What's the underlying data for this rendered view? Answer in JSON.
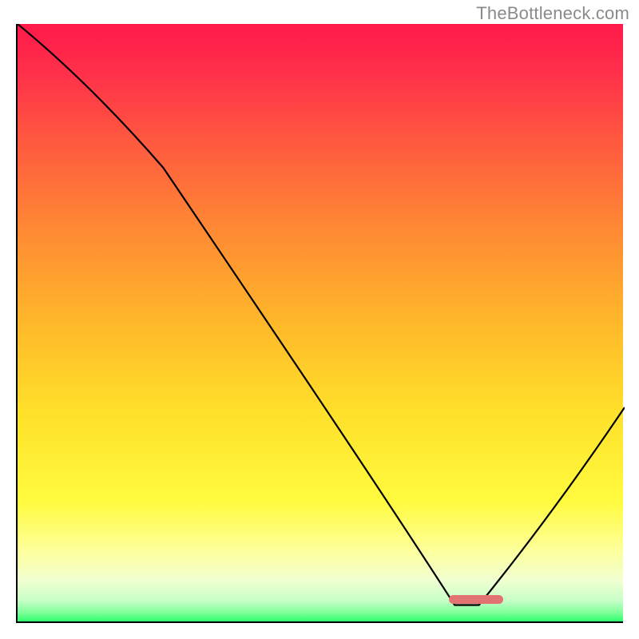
{
  "watermark": "TheBottleneck.com",
  "chart_data": {
    "type": "line",
    "title": "",
    "xlabel": "",
    "ylabel": "",
    "xlim": [
      0,
      100
    ],
    "ylim": [
      0,
      100
    ],
    "x": [
      0,
      24,
      72,
      76,
      100
    ],
    "values": [
      100,
      76,
      3,
      3,
      36
    ],
    "annotations": [
      {
        "name": "optimal-marker",
        "x_start": 71,
        "x_end": 80,
        "y": 4
      }
    ],
    "background_gradient": {
      "stops": [
        {
          "offset": 0.0,
          "color": "#ff1a4a"
        },
        {
          "offset": 0.08,
          "color": "#ff2f4a"
        },
        {
          "offset": 0.2,
          "color": "#ff5a3f"
        },
        {
          "offset": 0.35,
          "color": "#ff8b33"
        },
        {
          "offset": 0.5,
          "color": "#ffb82a"
        },
        {
          "offset": 0.65,
          "color": "#ffe02a"
        },
        {
          "offset": 0.8,
          "color": "#fffb3f"
        },
        {
          "offset": 0.88,
          "color": "#fdff9a"
        },
        {
          "offset": 0.93,
          "color": "#f2ffd0"
        },
        {
          "offset": 0.965,
          "color": "#c8ffc8"
        },
        {
          "offset": 0.985,
          "color": "#7fff9a"
        },
        {
          "offset": 1.0,
          "color": "#2fff70"
        }
      ]
    }
  },
  "colors": {
    "axis": "#000000",
    "curve": "#000000",
    "marker": "#e27373",
    "watermark": "#8a8a8a"
  }
}
